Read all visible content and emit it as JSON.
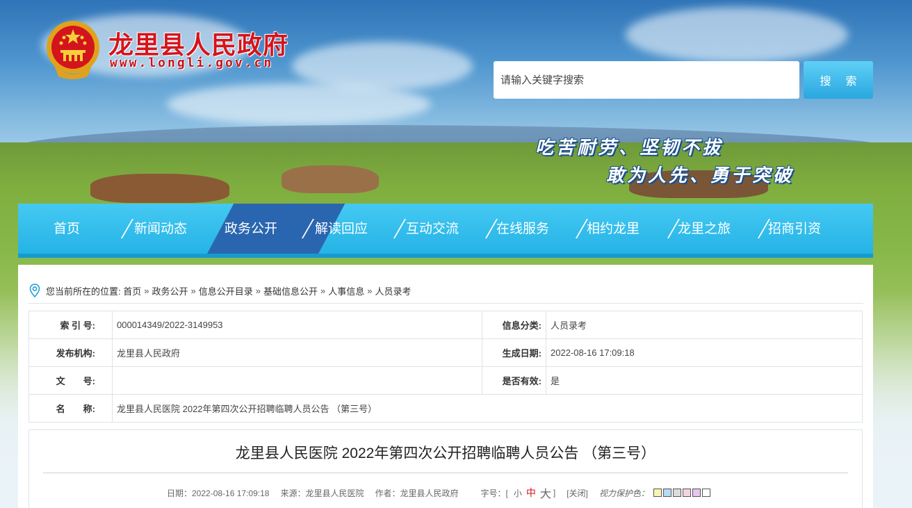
{
  "header": {
    "site_title": "龙里县人民政府",
    "site_url": "www.longli.gov.cn",
    "search_placeholder": "请输入关键字搜索",
    "search_button": "搜 索",
    "slogan_line1": "吃苦耐劳、坚韧不拔",
    "slogan_line2": "敢为人先、勇于突破"
  },
  "nav": {
    "items": [
      {
        "label": "首页",
        "active": false
      },
      {
        "label": "新闻动态",
        "active": false
      },
      {
        "label": "政务公开",
        "active": true
      },
      {
        "label": "解读回应",
        "active": false
      },
      {
        "label": "互动交流",
        "active": false
      },
      {
        "label": "在线服务",
        "active": false
      },
      {
        "label": "相约龙里",
        "active": false
      },
      {
        "label": "龙里之旅",
        "active": false
      },
      {
        "label": "招商引资",
        "active": false
      }
    ]
  },
  "breadcrumb": {
    "prefix": "您当前所在的位置:",
    "items": [
      "首页",
      "政务公开",
      "信息公开目录",
      "基础信息公开",
      "人事信息",
      "人员录考"
    ],
    "separator": "»"
  },
  "meta": {
    "index_label": "索 引 号:",
    "index_value": "000014349/2022-3149953",
    "category_label": "信息分类:",
    "category_value": "人员录考",
    "publisher_label": "发布机构:",
    "publisher_value": "龙里县人民政府",
    "date_label": "生成日期:",
    "date_value": "2022-08-16 17:09:18",
    "doc_no_label": "文　　号:",
    "doc_no_value": "",
    "valid_label": "是否有效:",
    "valid_value": "是",
    "name_label": "名　　称:",
    "name_value": "龙里县人民医院 2022年第四次公开招聘临聘人员公告 （第三号）"
  },
  "article": {
    "title": "龙里县人民医院 2022年第四次公开招聘临聘人员公告 （第三号）",
    "date": "日期：2022-08-16 17:09:18",
    "source": "来源：龙里县人民医院",
    "author": "作者：龙里县人民政府",
    "font_size_label": "字号：[",
    "font_small": "小",
    "font_medium": "中",
    "font_large": "大",
    "font_close": "]",
    "close_label": "[关闭]",
    "eye_care_label": "视力保护色：",
    "eye_colors": [
      "#FAF3B7",
      "#B7DAF5",
      "#DCDCDC",
      "#F6D3DF",
      "#E6C6F0",
      "#FFFFFF"
    ]
  },
  "colors": {
    "accent": "#25B3E6",
    "nav_active": "#2A66B0",
    "brand_red": "#D4141C"
  }
}
